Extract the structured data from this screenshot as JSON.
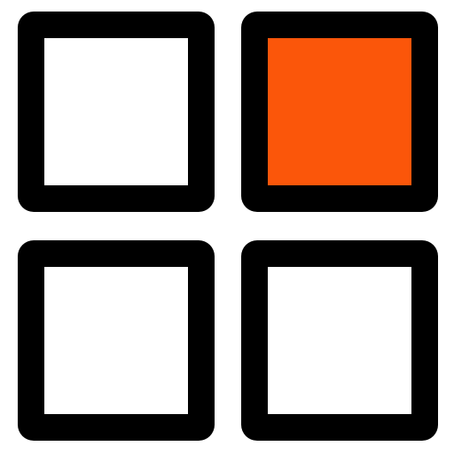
{
  "icon": {
    "name": "app-grid-icon",
    "outline_color": "#000000",
    "background_color": "#ffffff",
    "tiles": [
      {
        "id": "top-left",
        "fill": "#ffffff",
        "highlighted": false
      },
      {
        "id": "top-right",
        "fill": "#fb560a",
        "highlighted": true
      },
      {
        "id": "bottom-left",
        "fill": "#ffffff",
        "highlighted": false
      },
      {
        "id": "bottom-right",
        "fill": "#ffffff",
        "highlighted": false
      }
    ]
  }
}
